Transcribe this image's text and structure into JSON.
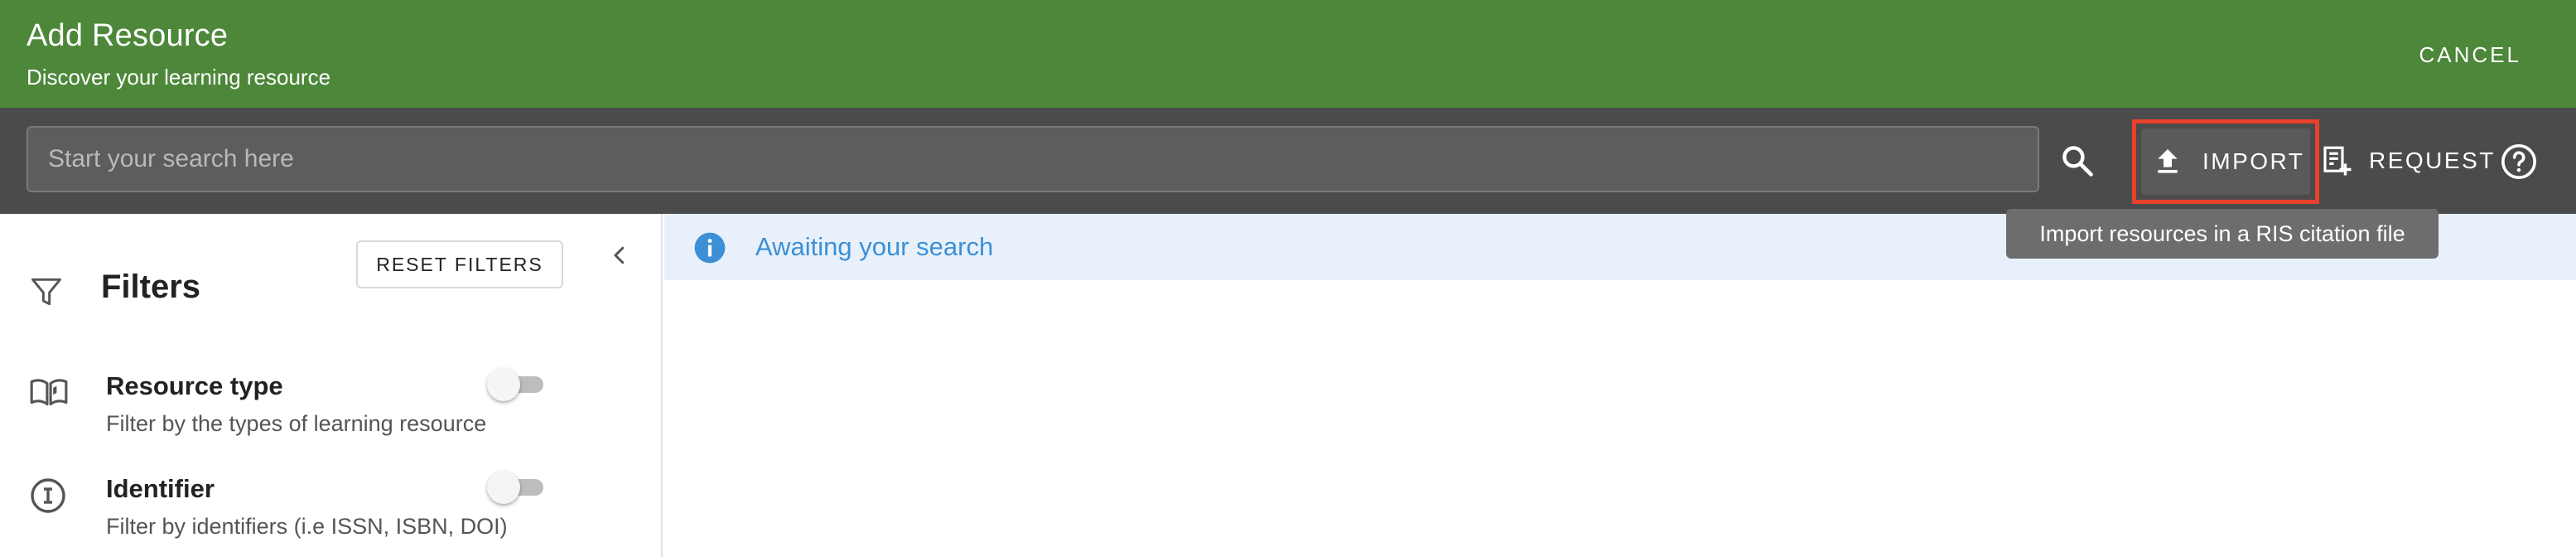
{
  "header": {
    "title": "Add Resource",
    "subtitle": "Discover your learning resource",
    "cancel_label": "CANCEL",
    "background_color": "#4d873a"
  },
  "search": {
    "placeholder": "Start your search here",
    "value": "",
    "search_icon": "search-icon"
  },
  "toolbar": {
    "import_label": "IMPORT",
    "import_icon": "upload-icon",
    "request_label": "REQUEST",
    "request_icon": "playlist-add-icon",
    "help_icon": "help-circle-icon",
    "highlight_color": "#e8412c"
  },
  "tooltip": {
    "text": "Import resources in a RIS citation file"
  },
  "sidebar": {
    "title": "Filters",
    "reset_label": "RESET FILTERS",
    "filters": [
      {
        "title": "Resource type",
        "description": "Filter by the types of learning resource",
        "icon": "open-book-icon",
        "enabled": false
      },
      {
        "title": "Identifier",
        "description": "Filter by identifiers (i.e ISSN, ISBN, DOI)",
        "icon": "identifier-icon",
        "enabled": false
      }
    ]
  },
  "main": {
    "status_text": "Awaiting your search",
    "status_icon": "info-icon",
    "status_color": "#3d8fd6"
  }
}
